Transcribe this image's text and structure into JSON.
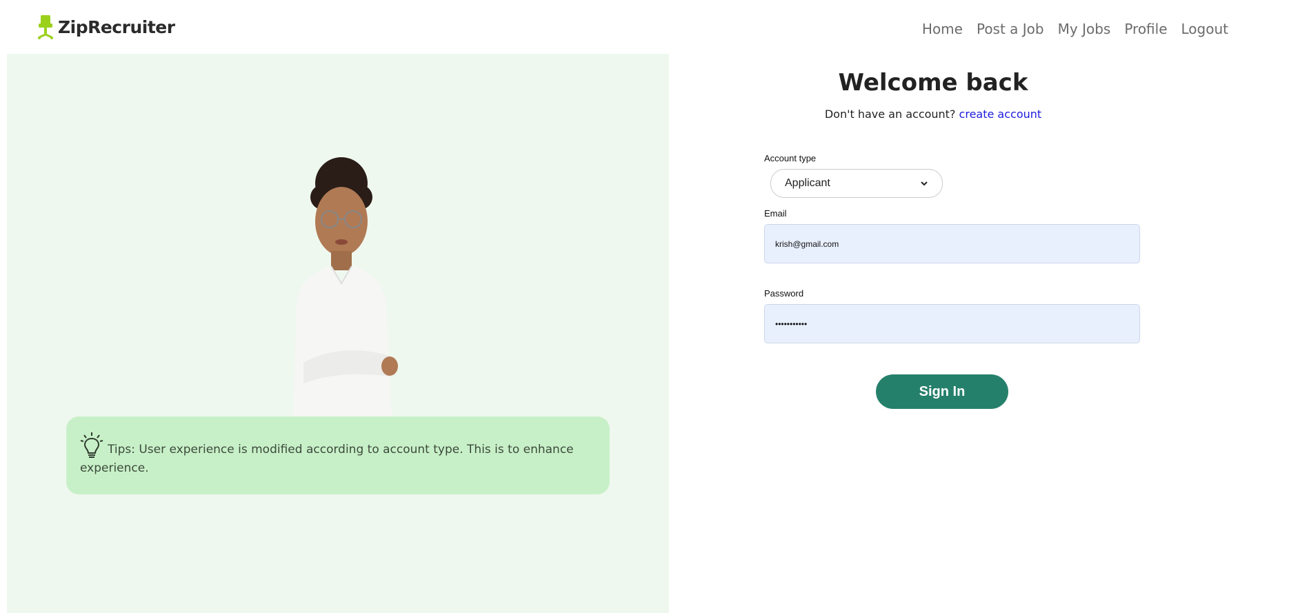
{
  "header": {
    "brand": "ZipRecruiter",
    "nav": [
      "Home",
      "Post a Job",
      "My Jobs",
      "Profile",
      "Logout"
    ]
  },
  "colors": {
    "brand_icon": "#9bd11b",
    "left_panel_bg": "#eff8ef",
    "tip_bg": "#c8f0c8",
    "primary_button": "#25806b",
    "link": "#1a1adb",
    "input_bg": "#e8f0fe"
  },
  "tip": {
    "icon": "lightbulb-icon",
    "text": "Tips: User experience is modified according to account type. This is to enhance experience."
  },
  "form": {
    "title": "Welcome back",
    "subtitle_prefix": "Don't have an account?",
    "subtitle_link": "create account",
    "account_type_label": "Account type",
    "account_type_value": "Applicant",
    "email_label": "Email",
    "email_value": "krish@gmail.com",
    "password_label": "Password",
    "password_value": "•••••••••••",
    "submit_label": "Sign In"
  }
}
